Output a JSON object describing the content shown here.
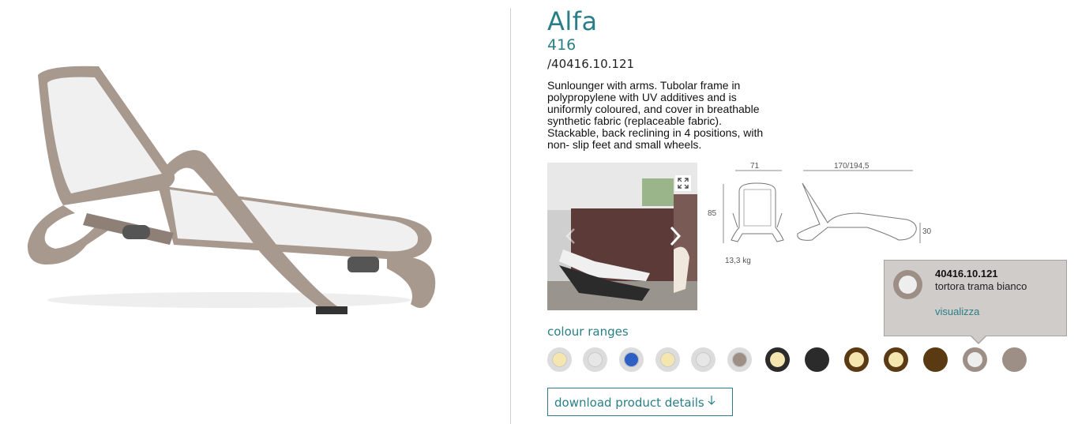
{
  "product": {
    "name": "Alfa",
    "code": "416",
    "reference": "/40416.10.121",
    "description": "Sunlounger with arms. Tubolar frame in polypropylene with UV additives and is uniformly coloured, and cover in breathable synthetic fabric (replaceable fabric). Stackable, back reclining in 4 positions, with non- slip feet and small wheels."
  },
  "gallery": {
    "prev_icon": "chevron-left-icon",
    "next_icon": "chevron-right-icon",
    "expand_icon": "expand-icon"
  },
  "dimensions": {
    "width": "71",
    "length": "170/194,5",
    "height": "85",
    "seat_height": "30",
    "weight": "13,3 kg"
  },
  "colours": {
    "label": "colour ranges",
    "swatches": [
      {
        "ring": "#dcdcdc",
        "fill": "#f5e6b0"
      },
      {
        "ring": "#dcdcdc",
        "fill": "#e6e6e6"
      },
      {
        "ring": "#dcdcdc",
        "fill": "#2d5fc4"
      },
      {
        "ring": "#dcdcdc",
        "fill": "#f5e6b0"
      },
      {
        "ring": "#dcdcdc",
        "fill": "#e6e6e6"
      },
      {
        "ring": "#dcdcdc",
        "fill": "#9d8f86"
      },
      {
        "ring": "#2b2b2b",
        "fill": "#f5e6b0"
      },
      {
        "ring": "#2b2b2b",
        "fill": "#2b2b2b"
      },
      {
        "ring": "#5a3a12",
        "fill": "#f5e6b0"
      },
      {
        "ring": "#5a3a12",
        "fill": "#f5e6b0"
      },
      {
        "ring": "#5a3a12",
        "fill": "#5a3a12"
      },
      {
        "ring": "#9d8f86",
        "fill": "#eeeeee"
      },
      {
        "ring": "#9d8f86",
        "fill": "#9d8f86"
      }
    ]
  },
  "tooltip": {
    "code": "40416.10.121",
    "name": "tortora trama bianco",
    "link": "visualizza"
  },
  "download": {
    "label": "download product details",
    "icon": "arrow-down-icon"
  }
}
